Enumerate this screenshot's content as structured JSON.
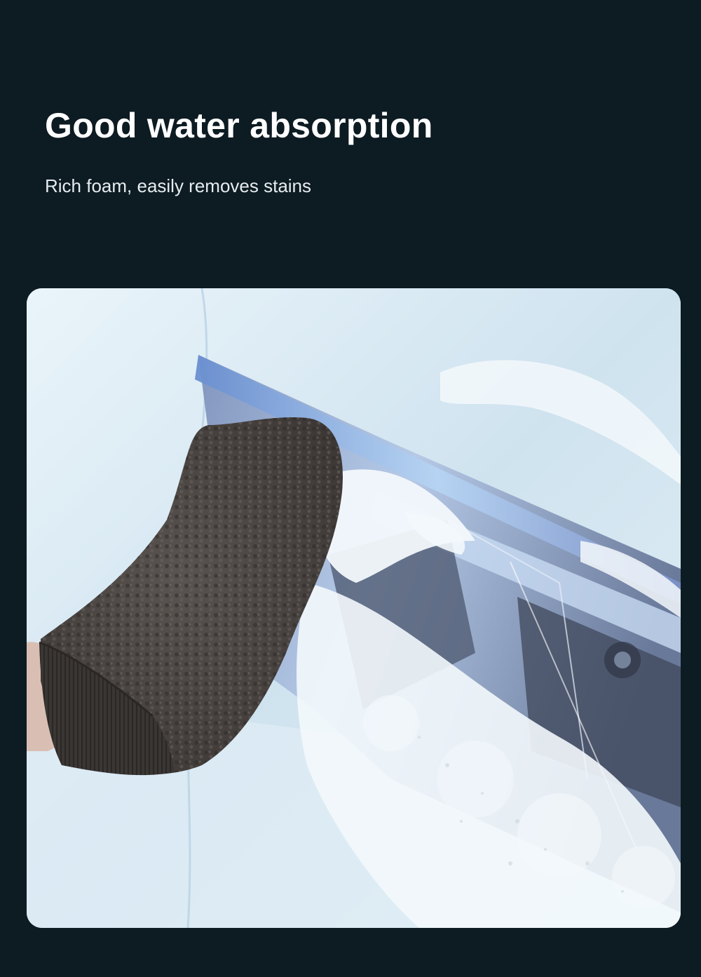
{
  "headline": "Good water absorption",
  "subline": "Rich foam, easily removes stains",
  "photo": {
    "subject": "grey microfiber wash mitt on hand wiping foamy car headlight",
    "colors": {
      "page_background": "#0d1b22",
      "car_body": "#d6e8f3",
      "mitt": "#4b4643",
      "foam": "#f2f7fb",
      "headlight_glass": "#8fa6c9"
    }
  }
}
